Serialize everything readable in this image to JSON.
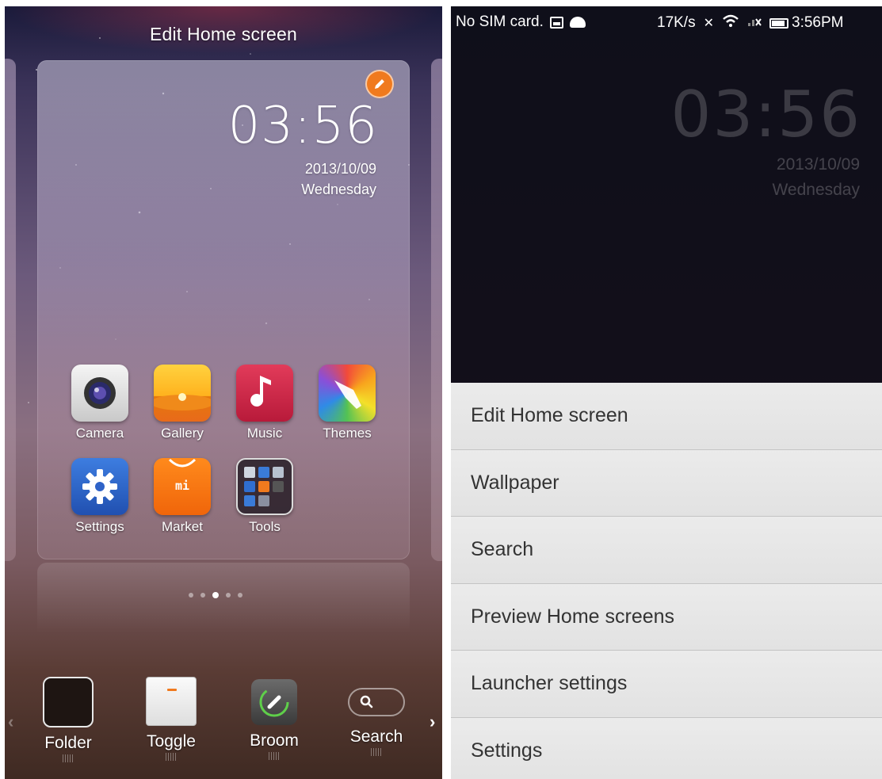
{
  "left_screen": {
    "title": "Edit Home screen",
    "clock": "03:56",
    "date": "2013/10/09",
    "weekday": "Wednesday",
    "apps_row1": [
      {
        "label": "Camera",
        "icon": "camera-icon"
      },
      {
        "label": "Gallery",
        "icon": "gallery-icon"
      },
      {
        "label": "Music",
        "icon": "music-icon"
      },
      {
        "label": "Themes",
        "icon": "themes-icon"
      }
    ],
    "apps_row2": [
      {
        "label": "Settings",
        "icon": "settings-gear-icon"
      },
      {
        "label": "Market",
        "icon": "market-icon",
        "badge": "mi"
      },
      {
        "label": "Tools",
        "icon": "tools-folder-icon"
      }
    ],
    "page_indicator": {
      "count": 5,
      "active": 3
    },
    "dock": [
      {
        "label": "Folder",
        "icon": "folder-widget-icon"
      },
      {
        "label": "Toggle",
        "icon": "toggle-widget-icon"
      },
      {
        "label": "Broom",
        "icon": "broom-widget-icon"
      },
      {
        "label": "Search",
        "icon": "search-widget-icon"
      }
    ],
    "colors": {
      "accent_orange": "#f07a1e"
    }
  },
  "right_screen": {
    "status_bar": {
      "carrier": "No SIM card.",
      "speed": "17K/s",
      "time": "3:56PM"
    },
    "clock": "03:56",
    "date": "2013/10/09",
    "weekday": "Wednesday",
    "menu": [
      {
        "label": "Edit Home screen"
      },
      {
        "label": "Wallpaper"
      },
      {
        "label": "Search"
      },
      {
        "label": "Preview Home screens"
      },
      {
        "label": "Launcher settings"
      },
      {
        "label": "Settings"
      }
    ]
  }
}
